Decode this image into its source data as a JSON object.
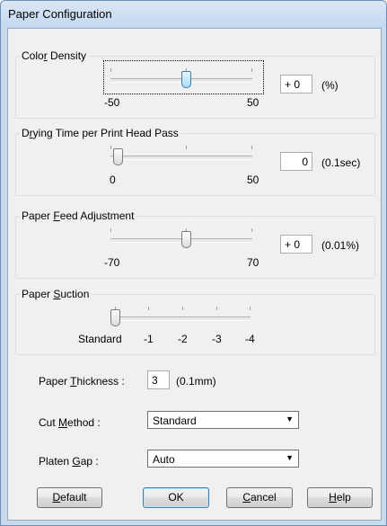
{
  "window": {
    "title": "Paper Configuration"
  },
  "color_density": {
    "label_pre": "Colo",
    "label_mn": "r",
    "label_post": " Density",
    "min_label": "-50",
    "max_label": "50",
    "min": -50,
    "max": 50,
    "value": 0,
    "display_value": "+ 0",
    "unit": "(%)"
  },
  "drying_time": {
    "label_pre": "D",
    "label_mn": "r",
    "label_post": "ying Time per Print Head Pass",
    "min_label": "0",
    "max_label": "50",
    "min": 0,
    "max": 50,
    "value": 0,
    "display_value": "0",
    "unit": "(0.1sec)"
  },
  "paper_feed": {
    "label_pre": "Paper ",
    "label_mn": "F",
    "label_post": "eed Adjustment",
    "min_label": "-70",
    "max_label": "70",
    "min": -70,
    "max": 70,
    "value": 0,
    "display_value": "+ 0",
    "unit": "(0.01%)"
  },
  "paper_suction": {
    "label_pre": "Paper ",
    "label_mn": "S",
    "label_post": "uction",
    "levels": [
      "Standard",
      "-1",
      "-2",
      "-3",
      "-4"
    ],
    "selected": "Standard"
  },
  "paper_thickness": {
    "label_pre": "Paper ",
    "label_mn": "T",
    "label_post": "hickness :",
    "value": "3",
    "unit": "(0.1mm)"
  },
  "cut_method": {
    "label_pre": "Cut ",
    "label_mn": "M",
    "label_post": "ethod :",
    "selected": "Standard"
  },
  "platen_gap": {
    "label_pre": "Platen ",
    "label_mn": "G",
    "label_post": "ap :",
    "selected": "Auto"
  },
  "buttons": {
    "default_mn": "D",
    "default_rest": "efault",
    "ok": "OK",
    "cancel_mn": "C",
    "cancel_rest": "ancel",
    "help_mn": "H",
    "help_rest": "elp"
  }
}
